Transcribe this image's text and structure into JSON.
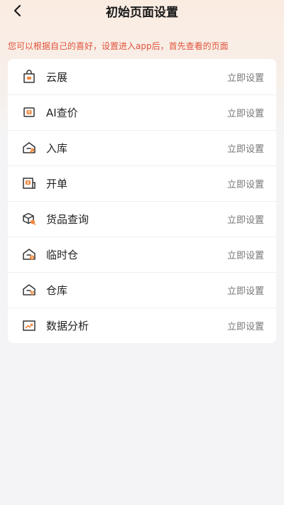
{
  "header": {
    "title": "初始页面设置",
    "back_icon": "chevron-left-icon"
  },
  "hint": "您可以根据自己的喜好，设置进入app后，首先查看的页面",
  "colors": {
    "accent": "#e0533b",
    "icon_stroke": "#333333",
    "icon_highlight": "#f0883e"
  },
  "items": [
    {
      "label": "云展",
      "action": "立即设置",
      "icon": "shopping-bag-icon"
    },
    {
      "label": "AI查价",
      "action": "立即设置",
      "icon": "price-tag-icon"
    },
    {
      "label": "入库",
      "action": "立即设置",
      "icon": "warehouse-in-icon"
    },
    {
      "label": "开单",
      "action": "立即设置",
      "icon": "invoice-icon"
    },
    {
      "label": "货品查询",
      "action": "立即设置",
      "icon": "package-search-icon"
    },
    {
      "label": "临时仓",
      "action": "立即设置",
      "icon": "temp-warehouse-icon"
    },
    {
      "label": "仓库",
      "action": "立即设置",
      "icon": "warehouse-icon"
    },
    {
      "label": "数据分析",
      "action": "立即设置",
      "icon": "chart-icon"
    }
  ]
}
